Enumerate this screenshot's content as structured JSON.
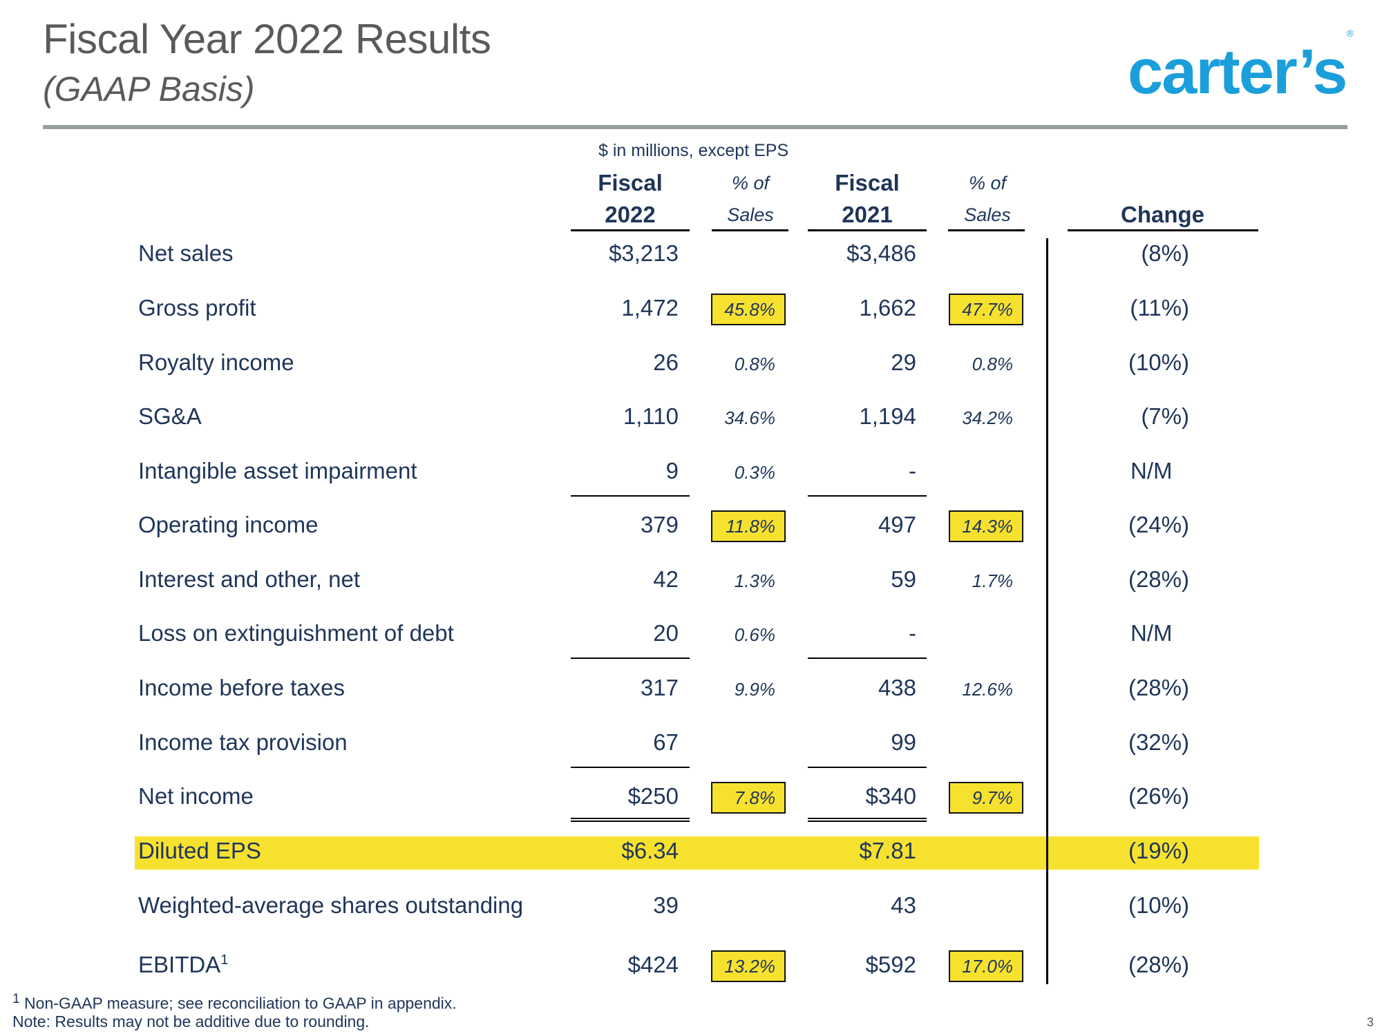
{
  "header": {
    "title": "Fiscal Year 2022 Results",
    "subtitle": "(GAAP Basis)",
    "logo_text": "carter’s",
    "logo_mark": "®",
    "brand_color": "#1a9fdb"
  },
  "table": {
    "units_note": "$ in millions, except EPS",
    "columns": {
      "fy22_line1": "Fiscal",
      "fy22_line2": "2022",
      "pct22_line1": "% of",
      "pct22_line2": "Sales",
      "fy21_line1": "Fiscal",
      "fy21_line2": "2021",
      "pct21_line1": "% of",
      "pct21_line2": "Sales",
      "change": "Change"
    },
    "rows": [
      {
        "label": "Net sales",
        "fy22": "$3,213",
        "pct22": "",
        "fy21": "$3,486",
        "pct21": "",
        "change": "(8%)"
      },
      {
        "label": "Gross profit",
        "fy22": "1,472",
        "pct22": "45.8%",
        "fy21": "1,662",
        "pct21": "47.7%",
        "change": "(11%)",
        "highlight_pct": true
      },
      {
        "label": "Royalty income",
        "fy22": "26",
        "pct22": "0.8%",
        "fy21": "29",
        "pct21": "0.8%",
        "change": "(10%)"
      },
      {
        "label": "SG&A",
        "fy22": "1,110",
        "pct22": "34.6%",
        "fy21": "1,194",
        "pct21": "34.2%",
        "change": "(7%)"
      },
      {
        "label": "Intangible asset impairment",
        "fy22": "9",
        "pct22": "0.3%",
        "fy21": "-",
        "pct21": "",
        "change": "N/M"
      },
      {
        "label": "Operating income",
        "fy22": "379",
        "pct22": "11.8%",
        "fy21": "497",
        "pct21": "14.3%",
        "change": "(24%)",
        "highlight_pct": true
      },
      {
        "label": "Interest and other, net",
        "fy22": "42",
        "pct22": "1.3%",
        "fy21": "59",
        "pct21": "1.7%",
        "change": "(28%)"
      },
      {
        "label": "Loss on extinguishment of debt",
        "fy22": "20",
        "pct22": "0.6%",
        "fy21": "-",
        "pct21": "",
        "change": "N/M"
      },
      {
        "label": "Income before taxes",
        "fy22": "317",
        "pct22": "9.9%",
        "fy21": "438",
        "pct21": "12.6%",
        "change": "(28%)"
      },
      {
        "label": "Income tax provision",
        "fy22": "67",
        "pct22": "",
        "fy21": "99",
        "pct21": "",
        "change": "(32%)"
      },
      {
        "label": "Net income",
        "fy22": "$250",
        "pct22": "7.8%",
        "fy21": "$340",
        "pct21": "9.7%",
        "change": "(26%)",
        "highlight_pct": true
      },
      {
        "label": "Diluted EPS",
        "fy22": "$6.34",
        "pct22": "",
        "fy21": "$7.81",
        "pct21": "",
        "change": "(19%)",
        "highlight_row": true
      },
      {
        "label": "Weighted-average shares outstanding",
        "fy22": "39",
        "pct22": "",
        "fy21": "43",
        "pct21": "",
        "change": "(10%)"
      },
      {
        "label": "EBITDA",
        "label_sup": "1",
        "fy22": "$424",
        "pct22": "13.2%",
        "fy21": "$592",
        "pct21": "17.0%",
        "change": "(28%)",
        "highlight_pct": true
      }
    ]
  },
  "footer": {
    "footnote_mark": "1",
    "footnote": "Non-GAAP measure; see reconciliation to GAAP in appendix.",
    "note": "Note: Results may not be additive due to rounding.",
    "page_number": "3"
  },
  "colors": {
    "highlight": "#f7e12f",
    "text_navy": "#1f3559",
    "title_gray": "#5a5a5a"
  }
}
